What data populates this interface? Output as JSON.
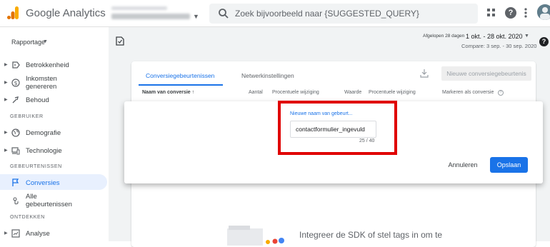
{
  "app": {
    "title": "Google Analytics",
    "account_label_blurred": "",
    "brand_orange": "#f9ab00",
    "brand_orange_dark": "#e37400"
  },
  "search": {
    "placeholder": "Zoek bijvoorbeeld naar {SUGGESTED_QUERY}"
  },
  "header_icons": [
    "apps-icon",
    "help-icon",
    "more-icon",
    "avatar"
  ],
  "help_glyph": "?",
  "sidebar": {
    "report_select": "Rapportage",
    "items": [
      {
        "label": "Betrokkenheid",
        "icon": "engagement-icon",
        "expandable": true
      },
      {
        "label": "Inkomsten genereren",
        "icon": "monetization-icon",
        "expandable": true
      },
      {
        "label": "Behoud",
        "icon": "retention-icon",
        "expandable": true
      }
    ],
    "sections": [
      {
        "title": "GEBRUIKER",
        "items": [
          {
            "label": "Demografie",
            "icon": "globe-icon",
            "expandable": true
          },
          {
            "label": "Technologie",
            "icon": "devices-icon",
            "expandable": true
          }
        ]
      },
      {
        "title": "GEBEURTENISSEN",
        "items": [
          {
            "label": "Conversies",
            "icon": "flag-icon",
            "active": true
          },
          {
            "label": "Alle gebeurtenissen",
            "icon": "touch-icon"
          }
        ]
      },
      {
        "title": "ONTDEKKEN",
        "items": [
          {
            "label": "Analyse",
            "icon": "analysis-icon",
            "expandable": true
          }
        ]
      }
    ]
  },
  "date": {
    "range_label": "Afgelopen 28 dagen",
    "main": "1 okt. - 28 okt. 2020",
    "compare": "Compare: 3 sep. - 30 sep. 2020"
  },
  "card": {
    "tabs": [
      {
        "label": "Conversiegebeurtenissen",
        "active": true
      },
      {
        "label": "Netwerkinstellingen",
        "active": false
      }
    ],
    "new_event_button": "Nieuwe conversiegebeurtenis",
    "columns": [
      "Naam van conversie",
      "Aantal",
      "Procentuele wijziging",
      "Waarde",
      "Procentuele wijziging",
      "Markeren als conversie"
    ],
    "sort_glyph": "↑"
  },
  "dialog": {
    "field_label": "Nieuwe naam van gebeurt...",
    "input_value": "contactformulier_ingevuld",
    "char_count": "25 / 40",
    "cancel": "Annuleren",
    "save": "Opslaan"
  },
  "empty_state": {
    "text": "Integreer de SDK of stel tags in om te"
  },
  "colors": {
    "accent": "#1a73e8",
    "highlight": "#e00000",
    "active_nav_bg": "#e8f0fe"
  }
}
